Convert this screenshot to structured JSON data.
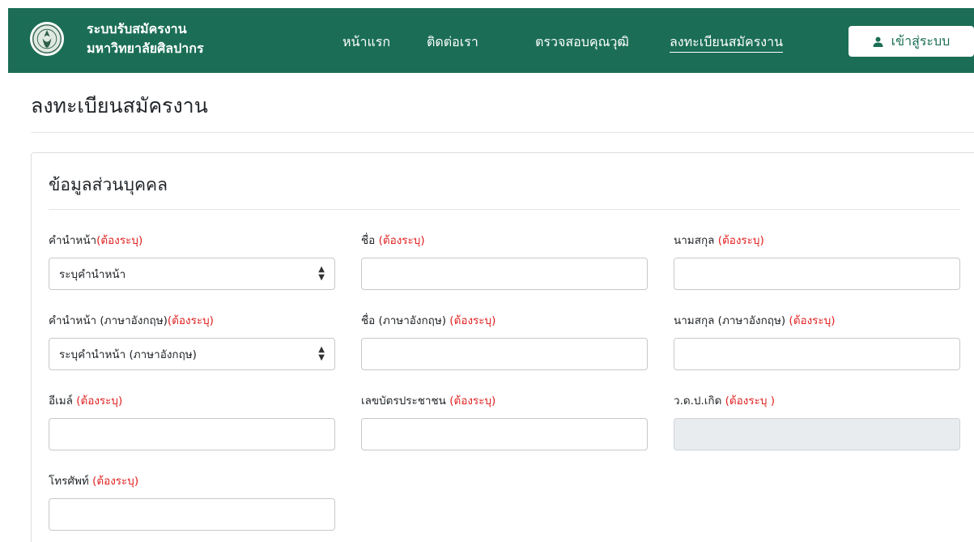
{
  "header": {
    "brand_line1": "ระบบรับสมัครงาน",
    "brand_line2": "มหาวิทยาลัยศิลปากร",
    "nav": [
      "หน้าแรก",
      "ติดต่อเรา",
      "ตรวจสอบคุณวุฒิ",
      "ลงทะเบียนสมัครงาน"
    ],
    "login_label": "เข้าสู่ระบบ",
    "colors": {
      "bar": "#1b6e55",
      "required": "#e02020"
    }
  },
  "page": {
    "title": "ลงทะเบียนสมัครงาน",
    "section_title": "ข้อมูลส่วนบุคคล"
  },
  "form": {
    "title_th": {
      "label": "คำนำหน้า",
      "req": "(ต้องระบุ)",
      "value": "ระบุคำนำหน้า"
    },
    "firstname_th": {
      "label": "ชื่อ ",
      "req": "(ต้องระบุ)"
    },
    "lastname_th": {
      "label": "นามสกุล ",
      "req": "(ต้องระบุ)"
    },
    "title_en": {
      "label": "คำนำหน้า (ภาษาอังกฤษ)",
      "req": "(ต้องระบุ)",
      "value": "ระบุคำนำหน้า (ภาษาอังกฤษ)"
    },
    "firstname_en": {
      "label": "ชื่อ (ภาษาอังกฤษ) ",
      "req": "(ต้องระบุ)"
    },
    "lastname_en": {
      "label": "นามสกุล (ภาษาอังกฤษ) ",
      "req": "(ต้องระบุ)"
    },
    "email": {
      "label": "อีเมล์ ",
      "req": "(ต้องระบุ)"
    },
    "id_card": {
      "label": "เลขบัตรประชาชน ",
      "req": "(ต้องระบุ)"
    },
    "birthdate": {
      "label": "ว.ด.ป.เกิด ",
      "req": "(ต้องระบุ )"
    },
    "phone": {
      "label": "โทรศัพท์ ",
      "req": "(ต้องระบุ)"
    }
  }
}
